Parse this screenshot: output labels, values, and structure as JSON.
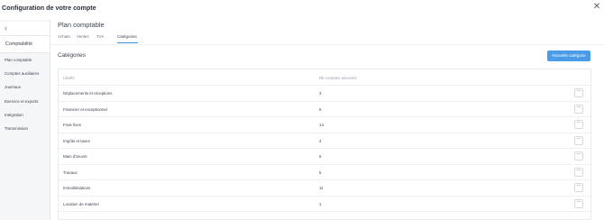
{
  "window": {
    "title": "Configuration de votre compte",
    "close_glyph": "✕"
  },
  "sidebar": {
    "back_glyph": "‹",
    "title": "Comptabilité",
    "items": [
      {
        "label": "Plan comptable"
      },
      {
        "label": "Comptes auxiliaires"
      },
      {
        "label": "Journaux"
      },
      {
        "label": "Exercice et exports"
      },
      {
        "label": "Intégration"
      },
      {
        "label": "Transmission"
      }
    ]
  },
  "main": {
    "title": "Plan comptable",
    "tabs": [
      {
        "label": "Achats"
      },
      {
        "label": "Ventes"
      },
      {
        "label": "TVA"
      },
      {
        "label": "Catégories",
        "active": true
      }
    ],
    "section_title": "Catégories",
    "new_button": "Nouvelle catégorie"
  },
  "table": {
    "columns": [
      "Libellé",
      "Nb comptes associés"
    ],
    "rows": [
      {
        "label": "Déplacements et réceptions",
        "count": "3"
      },
      {
        "label": "Financier et exceptionnel",
        "count": "5"
      },
      {
        "label": "Frais fixes",
        "count": "14"
      },
      {
        "label": "Impôts et taxes",
        "count": "4"
      },
      {
        "label": "Main d'œuvre",
        "count": "6"
      },
      {
        "label": "Travaux",
        "count": "5"
      },
      {
        "label": "Immobilisations",
        "count": "11"
      },
      {
        "label": "Location de matériel",
        "count": "1"
      }
    ],
    "more_glyph": "···"
  },
  "colors": {
    "accent": "#4a9be8",
    "tab_underline": "#3c8fdf",
    "sidebar_bg": "#f5f6f8"
  }
}
